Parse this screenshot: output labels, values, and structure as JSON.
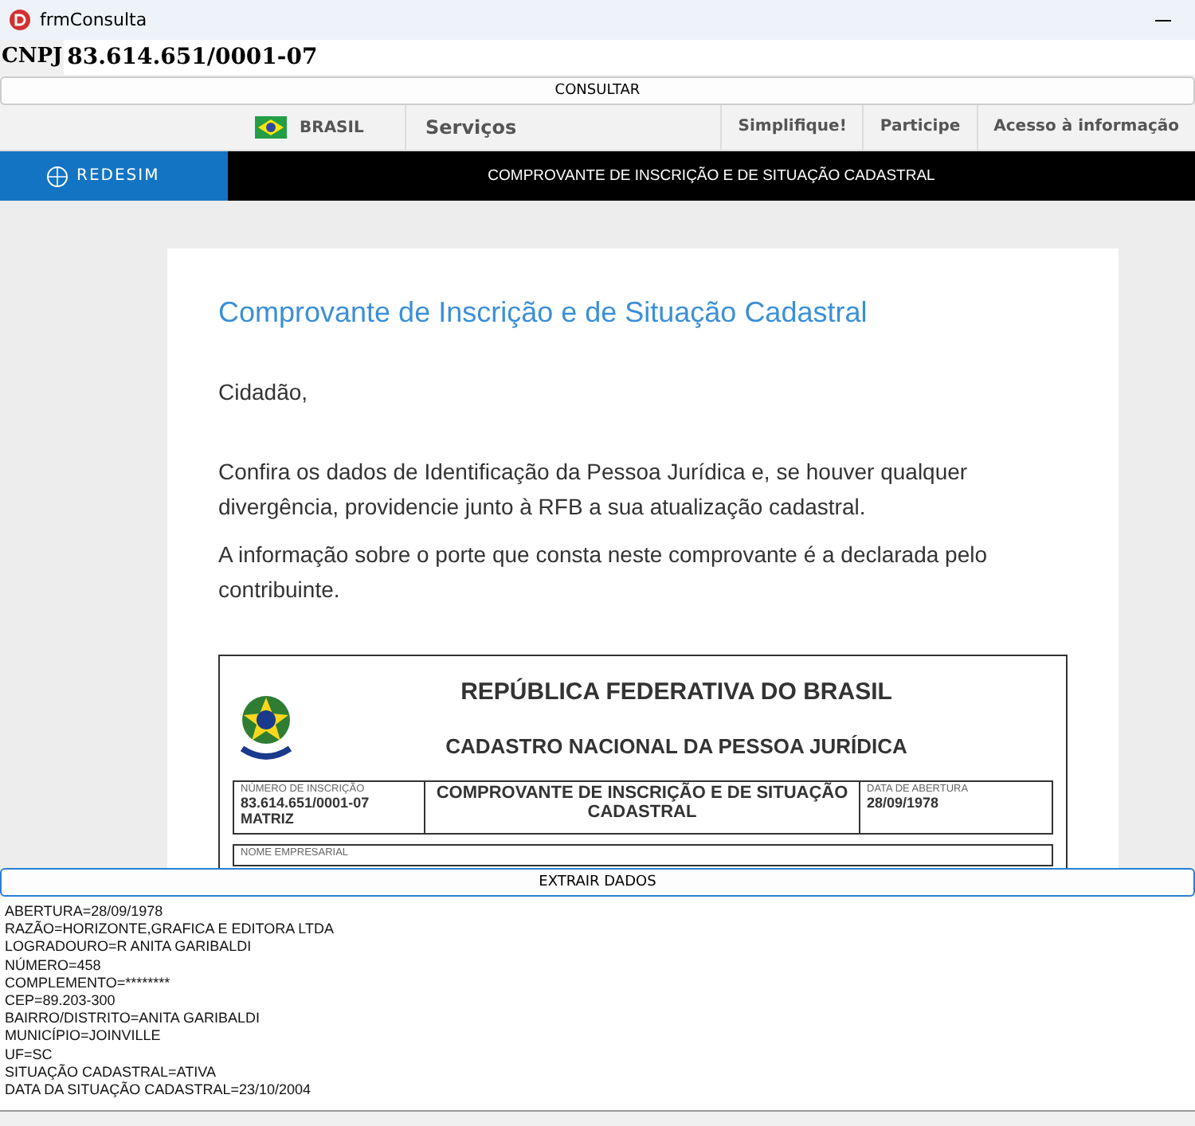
{
  "window": {
    "title": "frmConsulta"
  },
  "cnpj": {
    "label": "CNPJ",
    "value": "83.614.651/0001-07"
  },
  "consult_button": "CONSULTAR",
  "gov_bar": {
    "country": "BRASIL",
    "services": "Serviços",
    "links": [
      "Simplifique!",
      "Participe",
      "Acesso à informação"
    ]
  },
  "redesim": {
    "logo": "REDESIM",
    "title": "COMPROVANTE DE INSCRIÇÃO E DE SITUAÇÃO CADASTRAL"
  },
  "card": {
    "title": "Comprovante de Inscrição e de Situação Cadastral",
    "greeting": "Cidadão,",
    "paragraphs": [
      "Confira os dados de Identificação da Pessoa Jurídica e, se houver qualquer divergência, providencie junto à RFB a sua atualização cadastral.",
      "A informação sobre o porte que consta neste comprovante é a declarada pelo contribuinte."
    ]
  },
  "document": {
    "heading": "REPÚBLICA FEDERATIVA DO BRASIL",
    "subheading": "CADASTRO NACIONAL DA PESSOA JURÍDICA",
    "number": {
      "label": "NÚMERO DE INSCRIÇÃO",
      "value": "83.614.651/0001-07",
      "type": "MATRIZ"
    },
    "doc_title": "COMPROVANTE DE INSCRIÇÃO E DE SITUAÇÃO CADASTRAL",
    "opening": {
      "label": "DATA DE ABERTURA",
      "value": "28/09/1978"
    },
    "next_label": "NOME EMPRESARIAL"
  },
  "extract_button": "EXTRAIR DADOS",
  "output_lines": [
    "ABERTURA=28/09/1978",
    "RAZÃO=HORIZONTE,GRAFICA E EDITORA LTDA",
    "LOGRADOURO=R ANITA GARIBALDI",
    "NÚMERO=458",
    "COMPLEMENTO=********",
    "CEP=89.203-300",
    "BAIRRO/DISTRITO=ANITA GARIBALDI",
    "MUNICÍPIO=JOINVILLE",
    "UF=SC",
    "SITUAÇÃO CADASTRAL=ATIVA",
    "DATA DA SITUAÇÃO CADASTRAL=23/10/2004"
  ]
}
